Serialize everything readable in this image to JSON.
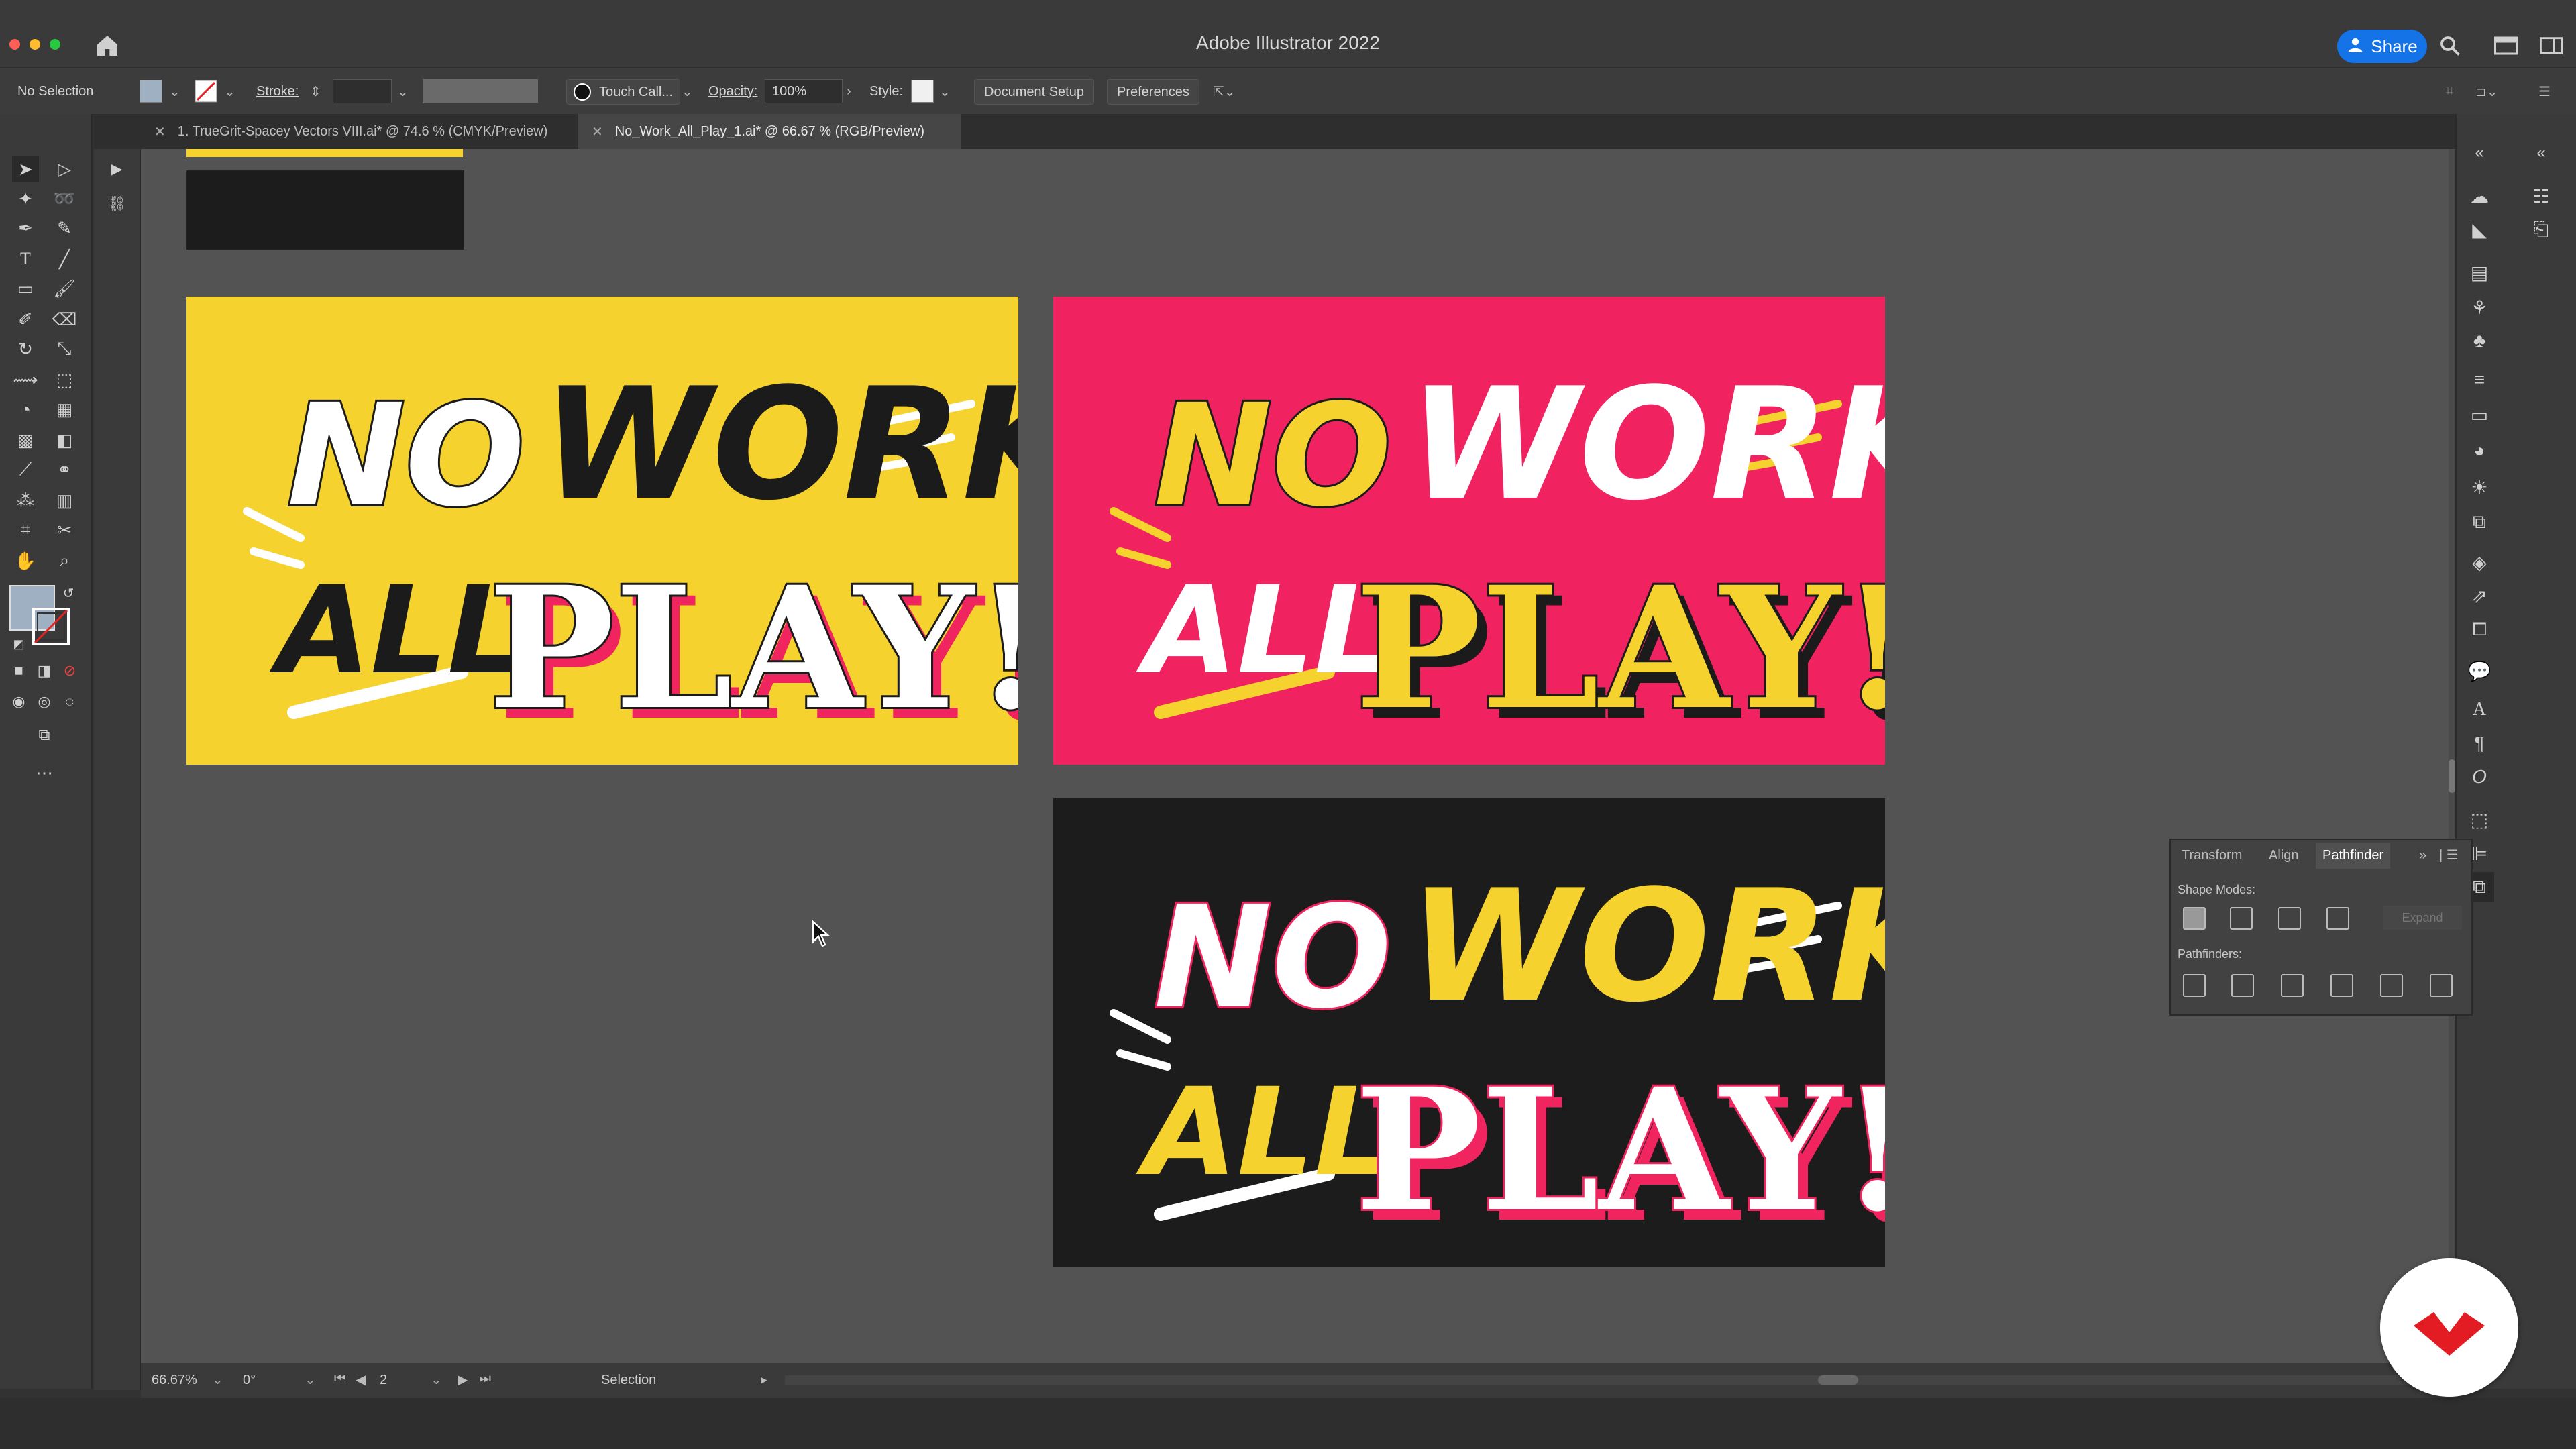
{
  "app": {
    "title": "Adobe Illustrator 2022",
    "share_label": "Share"
  },
  "control_bar": {
    "selection_status": "No Selection",
    "stroke_label": "Stroke:",
    "brush_name": "Touch Call...",
    "opacity_label": "Opacity:",
    "opacity_value": "100%",
    "style_label": "Style:",
    "document_setup_label": "Document Setup",
    "preferences_label": "Preferences"
  },
  "tabs": [
    {
      "label": "1. TrueGrit-Spacey Vectors VIII.ai* @ 74.6 % (CMYK/Preview)",
      "active": false
    },
    {
      "label": "No_Work_All_Play_1.ai* @ 66.67 % (RGB/Preview)",
      "active": true
    }
  ],
  "artboards": [
    {
      "bg": "#f5d22e",
      "line1_a": "NO",
      "line1_b": "WORK",
      "line2_a": "ALL",
      "line2_b": "PLAY!",
      "colors": {
        "script": "#1b1b1b",
        "block": "#ffffff",
        "shadow": "#f0245f",
        "stroke": "#1b1b1b"
      }
    },
    {
      "bg": "#f0225f",
      "line1_a": "NO",
      "line1_b": "WORK",
      "line2_a": "ALL",
      "line2_b": "PLAY!",
      "colors": {
        "script": "#ffffff",
        "block": "#f5d22e",
        "shadow": "#1b1b1b",
        "stroke": "#1b1b1b"
      }
    },
    {
      "bg": "#1c1c1c",
      "line1_a": "NO",
      "line1_b": "WORK",
      "line2_a": "ALL",
      "line2_b": "PLAY!",
      "colors": {
        "script": "#f5d22e",
        "block": "#ffffff",
        "shadow": "#f0245f",
        "stroke": "#f0245f"
      }
    }
  ],
  "pathfinder_panel": {
    "tabs": [
      "Transform",
      "Align",
      "Pathfinder"
    ],
    "active_tab": "Pathfinder",
    "shape_modes_label": "Shape Modes:",
    "expand_label": "Expand",
    "pathfinders_label": "Pathfinders:"
  },
  "status_bar": {
    "zoom": "66.67%",
    "rotation": "0°",
    "artboard_number": "2",
    "current_tool": "Selection"
  },
  "colors": {
    "accent": "#1473e6",
    "canvas_bg": "#535353",
    "fill_swatch": "#9eb0c2"
  }
}
